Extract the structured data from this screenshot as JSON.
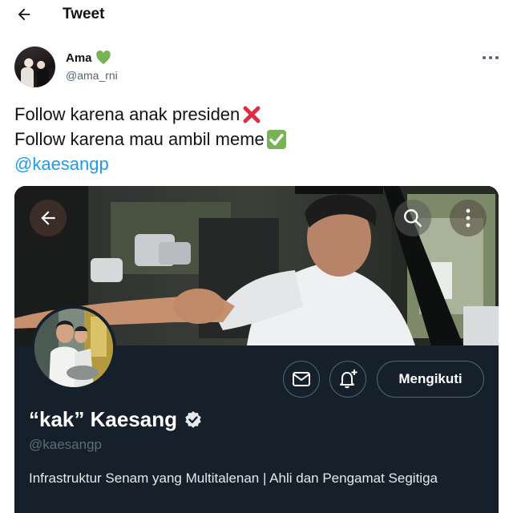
{
  "header": {
    "title": "Tweet",
    "back_icon": "arrow-left-icon"
  },
  "tweet": {
    "author": {
      "name": "Ama",
      "name_emoji": "green-heart-icon",
      "handle": "@ama_rni"
    },
    "more_icon": "more-horizontal-icon",
    "lines": [
      {
        "text": "Follow karena anak presiden",
        "emoji": "cross-mark-icon"
      },
      {
        "text": "Follow karena mau ambil meme",
        "emoji": "check-mark-button-icon"
      }
    ],
    "mention": "@kaesangp"
  },
  "card": {
    "display_name": "“kak” Kaesang",
    "handle": "@kaesangp",
    "bio": "Infrastruktur Senam yang Multitalenan | Ahli dan Pengamat Segitiga",
    "follow_label": "Mengikuti",
    "icons": [
      "arrow-left-icon",
      "search-icon",
      "more-vertical-icon",
      "mail-icon",
      "bell-plus-icon",
      "verified-badge-icon"
    ]
  },
  "colors": {
    "link": "#1d9bf0",
    "card_background": "#15202b",
    "muted": "#536471"
  }
}
